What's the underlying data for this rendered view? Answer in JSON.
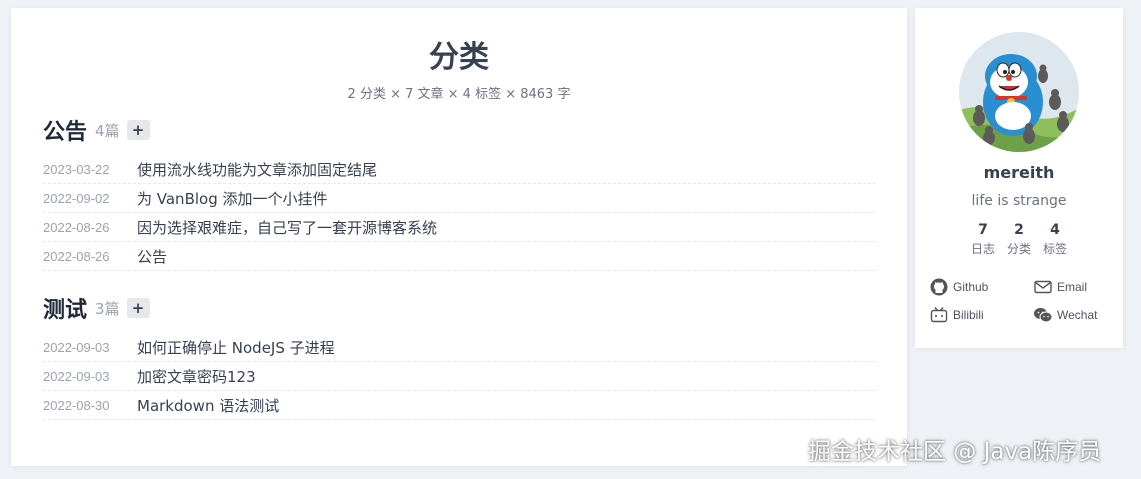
{
  "page": {
    "title": "分类",
    "stats": "2 分类 × 7 文章 × 4 标签 × 8463 字"
  },
  "categories": [
    {
      "name": "公告",
      "count": "4篇",
      "toggle": "+",
      "posts": [
        {
          "date": "2023-03-22",
          "title": "使用流水线功能为文章添加固定结尾"
        },
        {
          "date": "2022-09-02",
          "title": "为 VanBlog 添加一个小挂件"
        },
        {
          "date": "2022-08-26",
          "title": "因为选择艰难症，自己写了一套开源博客系统"
        },
        {
          "date": "2022-08-26",
          "title": "公告"
        }
      ]
    },
    {
      "name": "测试",
      "count": "3篇",
      "toggle": "+",
      "posts": [
        {
          "date": "2022-09-03",
          "title": "如何正确停止 NodeJS 子进程"
        },
        {
          "date": "2022-09-03",
          "title": "加密文章密码123"
        },
        {
          "date": "2022-08-30",
          "title": "Markdown 语法测试"
        }
      ]
    }
  ],
  "sidebar": {
    "author": "mereith",
    "motto": "life is strange",
    "stats": [
      {
        "value": "7",
        "label": "日志"
      },
      {
        "value": "2",
        "label": "分类"
      },
      {
        "value": "4",
        "label": "标签"
      }
    ],
    "links": [
      {
        "icon": "github-icon",
        "label": "Github"
      },
      {
        "icon": "email-icon",
        "label": "Email"
      },
      {
        "icon": "bilibili-icon",
        "label": "Bilibili"
      },
      {
        "icon": "wechat-icon",
        "label": "Wechat"
      }
    ]
  },
  "watermark": "掘金技术社区 @ Java陈序员"
}
